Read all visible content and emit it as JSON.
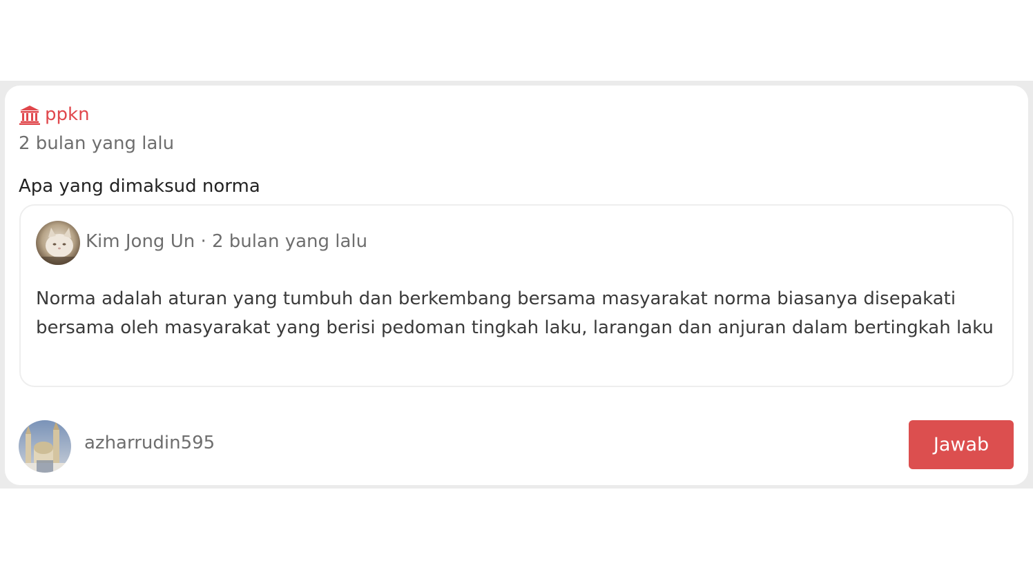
{
  "question_card": {
    "subject": {
      "icon": "bank-building-icon",
      "label": "ppkn"
    },
    "time": "2 bulan yang lalu",
    "question_text": "Apa yang dimaksud norma",
    "answer": {
      "author": "Kim Jong Un",
      "separator": " · ",
      "time": "2 bulan yang lalu",
      "text": "Norma adalah aturan yang tumbuh dan berkembang bersama masyarakat norma biasanya disepakati bersama oleh masyarakat yang berisi pedoman tingkah laku, larangan dan anjuran dalam bertingkah laku"
    },
    "footer": {
      "username": "azharrudin595",
      "answer_button_label": "Jawab"
    }
  },
  "colors": {
    "accent": "#e0474c",
    "button": "#dc4f4f",
    "muted_text": "#6e6e6e",
    "background_band": "#ebebeb"
  }
}
